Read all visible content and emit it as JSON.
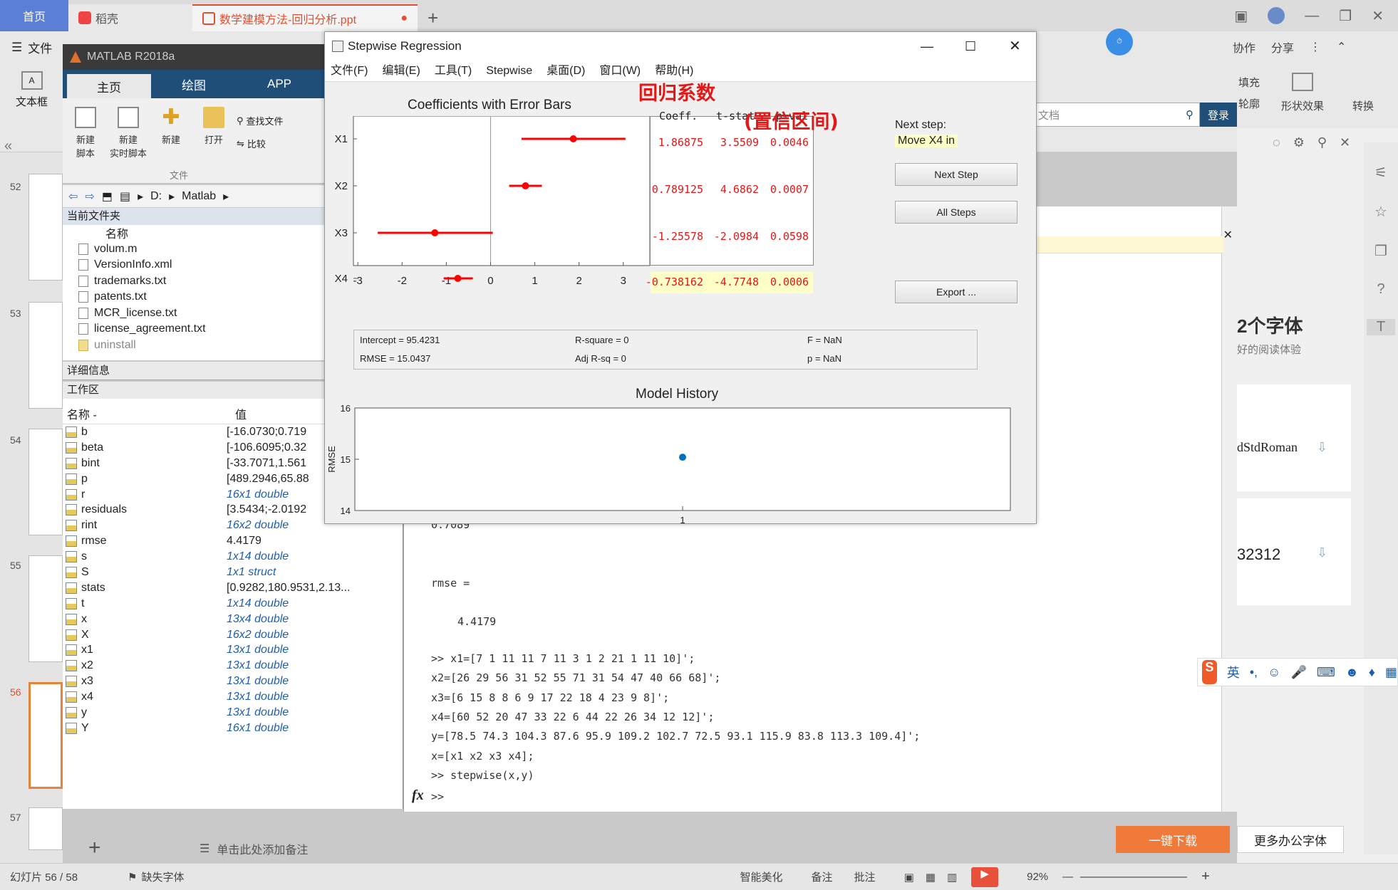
{
  "wps": {
    "tabs": {
      "home": "首页",
      "daoke": "稻壳",
      "doc": "数学建模方法-回归分析.ppt"
    },
    "ribbon": {
      "file": "文件",
      "textbox": "文本框",
      "collab": "协作",
      "share": "分享",
      "fill": "填充",
      "outline": "轮廓",
      "shape_effect": "形状效果",
      "convert": "转换",
      "search_placeholder": "文档",
      "login": "登录"
    },
    "slides": [
      "52",
      "53",
      "54",
      "55",
      "56",
      "57"
    ],
    "right_panel": {
      "font_promo_title": "2个字体",
      "font_promo_sub": "好的阅读体验",
      "font1": "dStdRoman",
      "font2": "32312",
      "download_btn": "一键下载",
      "more_fonts": "更多办公字体"
    },
    "notes_placeholder": "单击此处添加备注",
    "status": {
      "slide_count": "幻灯片 56 / 58",
      "missing_font": "缺失字体",
      "beautify": "智能美化",
      "notes": "备注",
      "comments": "批注",
      "zoom": "92%"
    }
  },
  "matlab": {
    "title": "MATLAB R2018a",
    "tabs": [
      "主页",
      "绘图",
      "APP"
    ],
    "toolbar": {
      "new_script": "新建\n脚本",
      "new_live": "新建\n实时脚本",
      "new": "新建",
      "open": "打开",
      "find_files": "查找文件",
      "compare": "比较",
      "section_file": "文件"
    },
    "path": [
      "D:",
      "Matlab"
    ],
    "current_folder_label": "当前文件夹",
    "name_col": "名称",
    "files": [
      "volum.m",
      "VersionInfo.xml",
      "trademarks.txt",
      "patents.txt",
      "MCR_license.txt",
      "license_agreement.txt",
      "uninstall"
    ],
    "details_label": "详细信息",
    "workspace_label": "工作区",
    "ws_cols": {
      "name": "名称 -",
      "value": "值"
    },
    "workspace": [
      {
        "name": "b",
        "value": "[-16.0730;0.719",
        "italic": false
      },
      {
        "name": "beta",
        "value": "[-106.6095;0.32",
        "italic": false
      },
      {
        "name": "bint",
        "value": "[-33.7071,1.561",
        "italic": false
      },
      {
        "name": "p",
        "value": "[489.2946,65.88",
        "italic": false
      },
      {
        "name": "r",
        "value": "16x1 double",
        "italic": true
      },
      {
        "name": "residuals",
        "value": "[3.5434;-2.0192",
        "italic": false
      },
      {
        "name": "rint",
        "value": "16x2 double",
        "italic": true
      },
      {
        "name": "rmse",
        "value": "4.4179",
        "italic": false
      },
      {
        "name": "s",
        "value": "1x14 double",
        "italic": true
      },
      {
        "name": "S",
        "value": "1x1 struct",
        "italic": true
      },
      {
        "name": "stats",
        "value": "[0.9282,180.9531,2.13...",
        "italic": false
      },
      {
        "name": "t",
        "value": "1x14 double",
        "italic": true
      },
      {
        "name": "x",
        "value": "13x4 double",
        "italic": true
      },
      {
        "name": "X",
        "value": "16x2 double",
        "italic": true
      },
      {
        "name": "x1",
        "value": "13x1 double",
        "italic": true
      },
      {
        "name": "x2",
        "value": "13x1 double",
        "italic": true
      },
      {
        "name": "x3",
        "value": "13x1 double",
        "italic": true
      },
      {
        "name": "x4",
        "value": "13x1 double",
        "italic": true
      },
      {
        "name": "y",
        "value": "13x1 double",
        "italic": true
      },
      {
        "name": "Y",
        "value": "16x1 double",
        "italic": true
      }
    ],
    "cmd": {
      "partial": "0.7089",
      "rmse_label": "rmse =",
      "rmse_value": "4.4179",
      "lines": [
        ">> x1=[7 1 11 11 7 11 3 1 2 21 1 11 10]';",
        "x2=[26 29 56 31 52 55 71 31 54 47 40 66 68]';",
        "x3=[6 15 8 8 6 9 17 22 18 4 23 9 8]';",
        "x4=[60 52 20 47 33 22 6 44 22 26 34 12 12]';",
        "y=[78.5 74.3 104.3 87.6 95.9 109.2 102.7 72.5 93.1 115.9 83.8 113.3 109.4]';",
        "x=[x1 x2 x3 x4];",
        ">> stepwise(x,y)"
      ],
      "prompt": ">>"
    }
  },
  "stepwise": {
    "title": "Stepwise Regression",
    "menu": [
      "文件(F)",
      "编辑(E)",
      "工具(T)",
      "Stepwise",
      "桌面(D)",
      "窗口(W)",
      "帮助(H)"
    ],
    "coef_title": "Coefficients with Error Bars",
    "table_headers": [
      "Coeff.",
      "t-stat",
      "p-val"
    ],
    "rows": [
      {
        "label": "X1",
        "coeff": "1.86875",
        "tstat": "3.5509",
        "pval": "0.0046",
        "highlight": false
      },
      {
        "label": "X2",
        "coeff": "0.789125",
        "tstat": "4.6862",
        "pval": "0.0007",
        "highlight": false
      },
      {
        "label": "X3",
        "coeff": "-1.25578",
        "tstat": "-2.0984",
        "pval": "0.0598",
        "highlight": false
      },
      {
        "label": "X4",
        "coeff": "-0.738162",
        "tstat": "-4.7748",
        "pval": "0.0006",
        "highlight": true
      }
    ],
    "next_step_label": "Next step:",
    "next_step_value": "Move X4 in",
    "buttons": {
      "next": "Next Step",
      "all": "All Steps",
      "export": "Export ..."
    },
    "stats": {
      "intercept": "Intercept = 95.4231",
      "rmse": "RMSE = 15.0437",
      "rsq": "R-square = 0",
      "adjrsq": "Adj R-sq = 0",
      "f": "F = NaN",
      "p": "p = NaN"
    },
    "history_title": "Model History",
    "history_ylabel": "RMSE",
    "annotations": {
      "coef_note": "回归系数",
      "ci_note": "(置信区间)"
    }
  },
  "chart_data": [
    {
      "type": "scatter",
      "title": "Coefficients with Error Bars",
      "categories": [
        "X1",
        "X2",
        "X3",
        "X4"
      ],
      "x_ticks": [
        -3,
        -2,
        -1,
        0,
        1,
        2,
        3
      ],
      "xlim": [
        -3.1,
        3.6
      ],
      "points": [
        {
          "label": "X1",
          "value": 1.87,
          "low": 0.7,
          "high": 3.05,
          "color": "#ff0000"
        },
        {
          "label": "X2",
          "value": 0.79,
          "low": 0.42,
          "high": 1.16,
          "color": "#ff0000"
        },
        {
          "label": "X3",
          "value": -1.26,
          "low": -2.55,
          "high": 0.05,
          "color": "#ff0000"
        },
        {
          "label": "X4",
          "value": -0.74,
          "low": -1.06,
          "high": -0.4,
          "color": "#ff0000"
        }
      ]
    },
    {
      "type": "scatter",
      "title": "Model History",
      "ylabel": "RMSE",
      "x": [
        1
      ],
      "y": [
        15.04
      ],
      "x_ticks": [
        1
      ],
      "y_ticks": [
        14,
        15,
        16
      ],
      "ylim": [
        14,
        16
      ],
      "color": "#0072bd"
    }
  ]
}
